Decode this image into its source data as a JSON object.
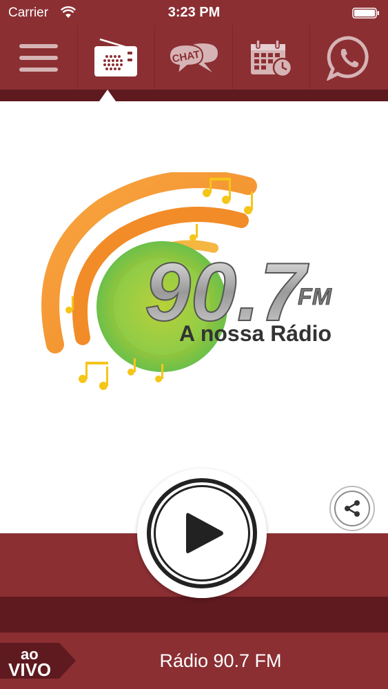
{
  "status": {
    "carrier": "Carrier",
    "time": "3:23 PM"
  },
  "nav": [
    {
      "icon": "menu-icon"
    },
    {
      "icon": "radio-icon"
    },
    {
      "icon": "chat-icon",
      "label": "CHAT"
    },
    {
      "icon": "calendar-clock-icon"
    },
    {
      "icon": "whatsapp-icon"
    }
  ],
  "logo": {
    "frequency": "90.7",
    "band": "FM",
    "slogan": "A nossa Rádio"
  },
  "footer": {
    "live_line1": "ao",
    "live_line2": "VIVO",
    "station": "Rádio 90.7 FM"
  },
  "colors": {
    "primary": "#8b2f33",
    "dark": "#5e1a1f",
    "orange": "#f28c28",
    "green": "#6cc04a",
    "yellow": "#f5c518"
  }
}
